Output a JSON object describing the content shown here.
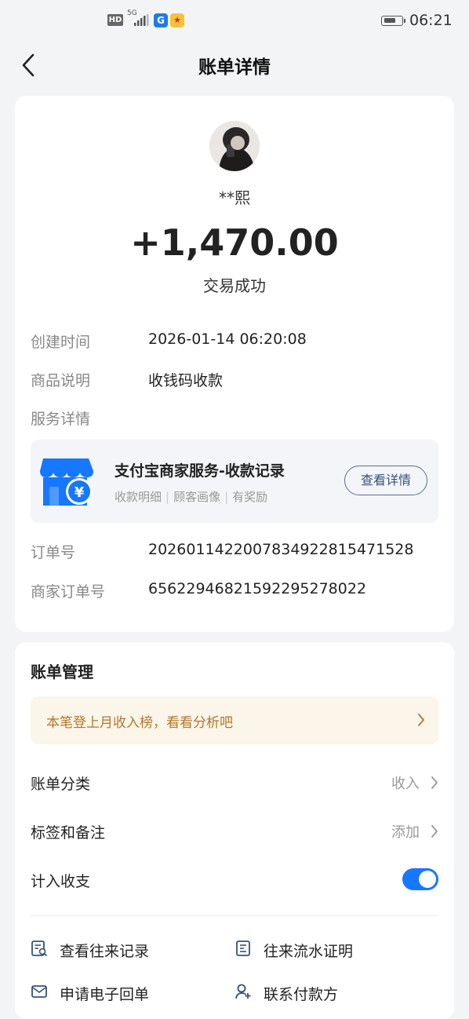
{
  "status_bar": {
    "network_badge": "HD",
    "network_type": "5G",
    "time": "06:21"
  },
  "header": {
    "title": "账单详情"
  },
  "transaction": {
    "payer_name": "**熙",
    "amount": "+1,470.00",
    "status": "交易成功"
  },
  "details": {
    "created_label": "创建时间",
    "created_value": "2026-01-14 06:20:08",
    "product_label": "商品说明",
    "product_value": "收钱码收款",
    "service_label": "服务详情",
    "order_label": "订单号",
    "order_value": "2026011422007834922815471528",
    "merchant_order_label": "商家订单号",
    "merchant_order_value": "65622946821592295278022"
  },
  "service_card": {
    "title": "支付宝商家服务-收款记录",
    "tags": [
      "收款明细",
      "顾客画像",
      "有奖励"
    ],
    "button_label": "查看详情",
    "icon": "shop-yuan-icon",
    "color": "#1677ff"
  },
  "management": {
    "title": "账单管理",
    "banner_text": "本笔登上月收入榜，看看分析吧",
    "category_label": "账单分类",
    "category_value": "收入",
    "tags_label": "标签和备注",
    "tags_value": "添加",
    "include_label": "计入收支",
    "include_enabled": true
  },
  "actions": [
    {
      "label": "查看往来记录",
      "icon": "record-search-icon"
    },
    {
      "label": "往来流水证明",
      "icon": "document-icon"
    },
    {
      "label": "申请电子回单",
      "icon": "mail-icon"
    },
    {
      "label": "联系付款方",
      "icon": "contact-person-icon"
    }
  ],
  "colors": {
    "accent": "#1677ff",
    "banner_text": "#b0782a",
    "banner_bg": "#fbf5ea"
  }
}
